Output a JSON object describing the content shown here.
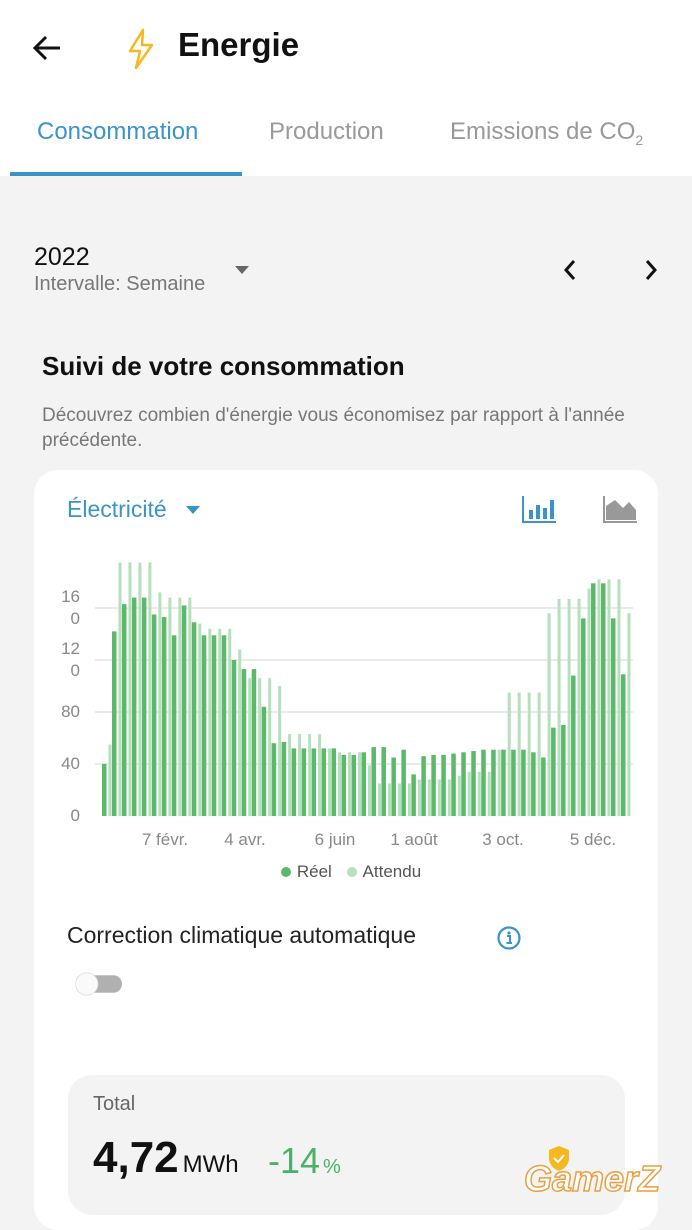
{
  "header": {
    "title": "Energie",
    "back_icon": "arrow-left-icon",
    "title_icon": "lightning-icon",
    "title_icon_color": "#f5b820"
  },
  "tabs": [
    {
      "label": "Consommation",
      "active": true
    },
    {
      "label": "Production"
    },
    {
      "label": "Emissions de CO",
      "sub": "2"
    }
  ],
  "period": {
    "year": "2022",
    "interval": "Intervalle: Semaine"
  },
  "section": {
    "title": "Suivi de votre consommation",
    "description": "Découvrez combien d'énergie vous économisez par rapport à l'année précédente."
  },
  "card": {
    "energy_type": "Électricité",
    "view_bar_icon": "bar-chart-icon",
    "view_area_icon": "area-chart-icon"
  },
  "chart_data": {
    "type": "bar",
    "ylim": [
      0,
      195
    ],
    "yticks": [
      "0",
      "40",
      "80",
      "120",
      "160"
    ],
    "xticks": [
      "7 févr.",
      "4 avr.",
      "6 juin",
      "1 août",
      "3 oct.",
      "5 déc."
    ],
    "grid": true,
    "legend": "bottom",
    "series": [
      {
        "name": "Réel",
        "color": "#5cb86a",
        "values": [
          40,
          142,
          163,
          168,
          168,
          155,
          153,
          139,
          162,
          149,
          139,
          139,
          139,
          120,
          113,
          113,
          84,
          56,
          57,
          52,
          52,
          52,
          52,
          52,
          47,
          47,
          49,
          53,
          53,
          45,
          51,
          32,
          46,
          47,
          47,
          48,
          49,
          50,
          51,
          51,
          51,
          51,
          51,
          49,
          45,
          68,
          70,
          108,
          152,
          179,
          179,
          152,
          109
        ]
      },
      {
        "name": "Attendu",
        "color": "#b5e0bb",
        "values": [
          55,
          195,
          195,
          195,
          195,
          172,
          168,
          168,
          168,
          148,
          144,
          144,
          144,
          128,
          106,
          106,
          106,
          100,
          63,
          63,
          63,
          63,
          52,
          49,
          49,
          49,
          39,
          25,
          25,
          25,
          25,
          28,
          28,
          28,
          28,
          31,
          34,
          34,
          34,
          51,
          95,
          95,
          95,
          95,
          156,
          167,
          167,
          167,
          175,
          182,
          182,
          182,
          156
        ]
      }
    ]
  },
  "climate": {
    "label": "Correction climatique automatique",
    "info_icon": "info-icon",
    "enabled": false
  },
  "total": {
    "label": "Total",
    "value": "4,72",
    "unit": "MWh",
    "change": "-14",
    "change_unit": "%",
    "badge_icon": "shield-check-icon"
  },
  "watermark": "GamerZ"
}
